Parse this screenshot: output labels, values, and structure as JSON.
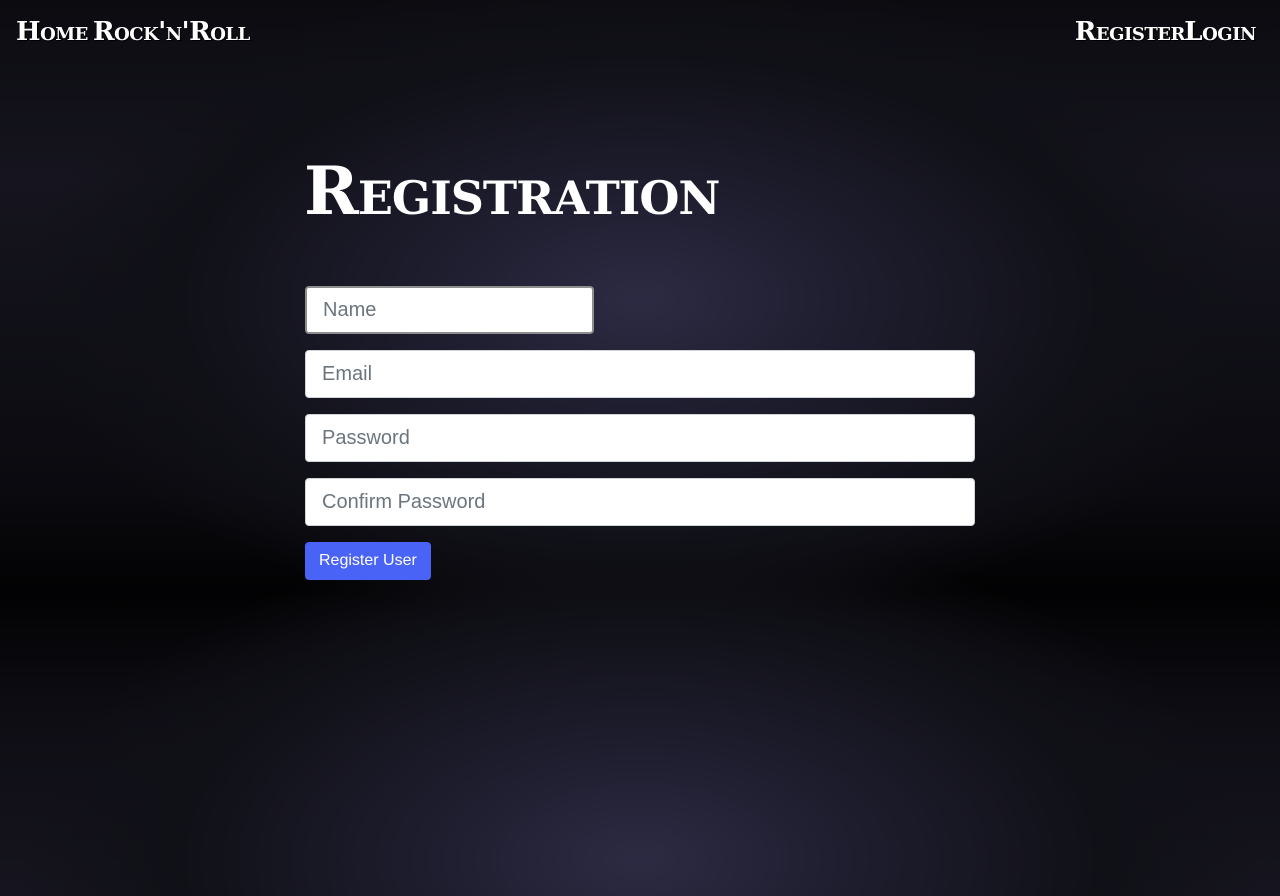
{
  "nav": {
    "left": [
      {
        "label": "Home"
      },
      {
        "label": "Rock'n'Roll"
      }
    ],
    "right": [
      {
        "label": "Register"
      },
      {
        "label": "Login"
      }
    ]
  },
  "page": {
    "title": "Registration"
  },
  "form": {
    "name": {
      "value": "",
      "placeholder": "Name"
    },
    "email": {
      "value": "",
      "placeholder": "Email"
    },
    "password": {
      "value": "",
      "placeholder": "Password"
    },
    "confirm_password": {
      "value": "",
      "placeholder": "Confirm Password"
    },
    "submit_label": "Register User"
  },
  "colors": {
    "button_bg": "#4a63f7",
    "text": "#ffffff",
    "background": "#0b0b10"
  }
}
